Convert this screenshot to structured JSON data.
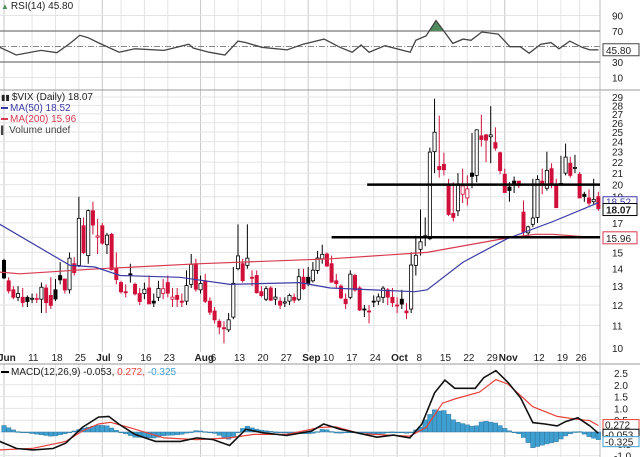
{
  "legend": {
    "rsi": "RSI(14) 45.80",
    "price": "$VIX (Daily) 18.07",
    "ma50": "MA(50) 18.52",
    "ma200": "MA(200) 15.96",
    "volume": "Volume undef",
    "macd_name": "MACD(12,26,9) -0.053,",
    "macd_signal": "0.272,",
    "macd_hist": "-0.325"
  },
  "colors": {
    "up": "#000000",
    "down": "#d0103a",
    "ma50": "#3b3ba6",
    "ma200": "#d83a50",
    "hist": "#3f9fd0",
    "rsi_fill": "#4e8a5a",
    "macd_signal": "#e8403a"
  },
  "chart_data": {
    "type": "candlestick",
    "symbol": "$VIX",
    "period": "Daily",
    "last_close": 18.07,
    "x_ticks": [
      {
        "i": 0,
        "label": "Jun",
        "month": true
      },
      {
        "i": 6,
        "label": "11"
      },
      {
        "i": 11,
        "label": "18"
      },
      {
        "i": 16,
        "label": "25"
      },
      {
        "i": 21,
        "label": "Jul",
        "month": true
      },
      {
        "i": 25,
        "label": "9"
      },
      {
        "i": 30,
        "label": "16"
      },
      {
        "i": 35,
        "label": "23"
      },
      {
        "i": 42,
        "label": "Aug",
        "month": true
      },
      {
        "i": 45,
        "label": "6"
      },
      {
        "i": 50,
        "label": "13"
      },
      {
        "i": 55,
        "label": "20"
      },
      {
        "i": 60,
        "label": "27"
      },
      {
        "i": 65,
        "label": "Sep",
        "month": true
      },
      {
        "i": 69,
        "label": "10"
      },
      {
        "i": 74,
        "label": "17"
      },
      {
        "i": 79,
        "label": "24"
      },
      {
        "i": 84,
        "label": "Oct",
        "month": true
      },
      {
        "i": 89,
        "label": "8"
      },
      {
        "i": 94,
        "label": "15"
      },
      {
        "i": 99,
        "label": "22"
      },
      {
        "i": 104,
        "label": "29"
      },
      {
        "i": 107,
        "label": "Nov",
        "month": true
      },
      {
        "i": 114,
        "label": "12"
      },
      {
        "i": 119,
        "label": "19"
      },
      {
        "i": 123,
        "label": "26"
      }
    ],
    "price_axis": {
      "scale": "log",
      "range": [
        10,
        29.5
      ],
      "ticks": [
        "29",
        "28",
        "27",
        "26",
        "25",
        "24",
        "23",
        "22",
        "21",
        "20",
        "19",
        "17",
        "15",
        "14",
        "13",
        "12",
        "11",
        "10"
      ]
    },
    "ohlc": [
      [
        14.5,
        14.6,
        13.4,
        13.46
      ],
      [
        13.3,
        13.5,
        12.6,
        12.74
      ],
      [
        12.8,
        13.0,
        12.3,
        12.4
      ],
      [
        12.4,
        13.0,
        12.2,
        12.6
      ],
      [
        12.4,
        12.9,
        11.9,
        12.13
      ],
      [
        12.4,
        12.5,
        11.9,
        12.18
      ],
      [
        12.3,
        12.6,
        12.1,
        12.35
      ],
      [
        12.3,
        12.6,
        12.1,
        12.34
      ],
      [
        12.3,
        13.2,
        11.6,
        12.94
      ],
      [
        12.9,
        13.1,
        11.6,
        12.12
      ],
      [
        12.5,
        13.5,
        11.8,
        11.98
      ],
      [
        12.8,
        13.4,
        12.2,
        12.31
      ],
      [
        13.6,
        14.4,
        13.1,
        13.35
      ],
      [
        13.4,
        13.4,
        12.6,
        12.79
      ],
      [
        12.8,
        15.0,
        12.6,
        14.64
      ],
      [
        14.3,
        14.7,
        13.6,
        13.77
      ],
      [
        14.2,
        19.0,
        14.1,
        17.33
      ],
      [
        16.8,
        17.4,
        14.9,
        14.99
      ],
      [
        14.8,
        18.0,
        14.3,
        17.91
      ],
      [
        17.9,
        18.6,
        16.2,
        16.85
      ],
      [
        16.0,
        17.3,
        14.9,
        16.09
      ],
      [
        16.8,
        17.0,
        15.5,
        15.6
      ],
      [
        15.5,
        16.3,
        14.9,
        16.14
      ],
      [
        16.2,
        16.3,
        13.9,
        13.94
      ],
      [
        14.0,
        15.0,
        13.1,
        13.37
      ],
      [
        13.2,
        13.3,
        12.6,
        12.69
      ],
      [
        12.7,
        13.1,
        12.4,
        12.64
      ],
      [
        13.7,
        14.3,
        13.2,
        13.63
      ],
      [
        13.1,
        13.2,
        12.5,
        12.58
      ],
      [
        12.6,
        12.9,
        12.0,
        12.18
      ],
      [
        12.6,
        13.2,
        12.3,
        12.83
      ],
      [
        12.9,
        13.6,
        12.1,
        12.06
      ],
      [
        12.2,
        12.6,
        11.9,
        12.1
      ],
      [
        12.4,
        13.3,
        12.2,
        12.87
      ],
      [
        12.6,
        13.4,
        12.3,
        12.86
      ],
      [
        13.2,
        13.6,
        12.4,
        12.62
      ],
      [
        12.3,
        12.9,
        11.9,
        12.41
      ],
      [
        12.5,
        12.9,
        11.9,
        12.29
      ],
      [
        12.2,
        12.6,
        11.9,
        12.14
      ],
      [
        12.2,
        13.9,
        12.0,
        13.03
      ],
      [
        13.1,
        14.9,
        12.9,
        14.26
      ],
      [
        14.3,
        14.6,
        12.7,
        12.83
      ],
      [
        12.8,
        13.6,
        12.6,
        13.15
      ],
      [
        13.3,
        13.7,
        12.1,
        12.19
      ],
      [
        12.2,
        12.4,
        11.5,
        11.64
      ],
      [
        11.7,
        11.9,
        11.1,
        11.27
      ],
      [
        11.2,
        11.3,
        10.6,
        10.93
      ],
      [
        10.9,
        11.2,
        10.2,
        10.85
      ],
      [
        10.8,
        11.6,
        10.7,
        11.27
      ],
      [
        11.4,
        14.1,
        11.3,
        13.16
      ],
      [
        14.0,
        16.9,
        13.9,
        14.78
      ],
      [
        14.3,
        14.6,
        13.2,
        13.31
      ],
      [
        14.2,
        16.9,
        14.0,
        14.64
      ],
      [
        13.5,
        13.9,
        13.0,
        13.45
      ],
      [
        13.6,
        13.9,
        12.6,
        12.64
      ],
      [
        12.7,
        13.0,
        12.4,
        12.49
      ],
      [
        12.3,
        13.0,
        12.2,
        12.86
      ],
      [
        12.9,
        13.0,
        12.2,
        12.25
      ],
      [
        12.3,
        12.9,
        12.0,
        12.41
      ],
      [
        12.2,
        12.4,
        11.8,
        11.99
      ],
      [
        12.1,
        12.4,
        11.9,
        12.16
      ],
      [
        12.2,
        12.6,
        12.0,
        12.5
      ],
      [
        12.4,
        12.6,
        12.1,
        12.25
      ],
      [
        12.3,
        14.0,
        12.2,
        13.53
      ],
      [
        13.5,
        14.0,
        12.8,
        12.86
      ],
      [
        13.5,
        14.1,
        13.0,
        13.16
      ],
      [
        13.3,
        14.4,
        13.2,
        13.91
      ],
      [
        13.9,
        15.1,
        13.7,
        14.65
      ],
      [
        14.6,
        15.5,
        14.3,
        14.88
      ],
      [
        14.9,
        15.0,
        14.1,
        14.16
      ],
      [
        14.3,
        14.8,
        13.2,
        13.22
      ],
      [
        13.3,
        13.7,
        12.9,
        13.14
      ],
      [
        13.0,
        13.1,
        12.3,
        12.37
      ],
      [
        12.3,
        12.6,
        11.8,
        12.07
      ],
      [
        12.4,
        13.9,
        12.3,
        13.68
      ],
      [
        13.6,
        13.7,
        12.7,
        12.79
      ],
      [
        12.9,
        13.0,
        11.7,
        11.75
      ],
      [
        11.8,
        12.0,
        11.4,
        11.8
      ],
      [
        11.7,
        12.0,
        11.1,
        11.68
      ],
      [
        12.2,
        12.5,
        11.9,
        12.2
      ],
      [
        12.2,
        12.6,
        12.0,
        12.42
      ],
      [
        12.4,
        13.0,
        12.1,
        12.89
      ],
      [
        12.8,
        12.9,
        12.0,
        12.41
      ],
      [
        12.4,
        12.9,
        11.9,
        12.12
      ],
      [
        12.0,
        12.4,
        11.6,
        12.0
      ],
      [
        12.3,
        12.8,
        11.8,
        12.05
      ],
      [
        11.7,
        12.1,
        11.3,
        11.61
      ],
      [
        11.8,
        15.0,
        11.6,
        14.22
      ],
      [
        14.2,
        16.1,
        13.6,
        14.82
      ],
      [
        15.2,
        18.0,
        14.8,
        15.69
      ],
      [
        16.1,
        17.4,
        15.4,
        15.95
      ],
      [
        15.9,
        23.4,
        15.8,
        22.96
      ],
      [
        23.0,
        28.8,
        21.0,
        24.98
      ],
      [
        21.6,
        26.8,
        20.6,
        21.31
      ],
      [
        21.8,
        22.9,
        20.8,
        21.3
      ],
      [
        20.0,
        20.5,
        17.5,
        17.62
      ],
      [
        17.7,
        20.2,
        17.1,
        17.4
      ],
      [
        17.9,
        21.0,
        17.5,
        20.06
      ],
      [
        19.2,
        21.4,
        18.5,
        19.89
      ],
      [
        18.9,
        20.8,
        18.3,
        19.64
      ],
      [
        21.0,
        24.9,
        19.7,
        20.71
      ],
      [
        20.8,
        25.3,
        20.2,
        25.23
      ],
      [
        24.6,
        26.9,
        23.5,
        24.22
      ],
      [
        24.7,
        24.8,
        22.0,
        24.16
      ],
      [
        24.5,
        27.9,
        21.9,
        24.7
      ],
      [
        23.9,
        25.5,
        23.1,
        23.35
      ],
      [
        22.9,
        23.0,
        20.9,
        21.23
      ],
      [
        20.9,
        21.4,
        19.3,
        19.34
      ],
      [
        19.8,
        20.2,
        18.6,
        19.51
      ],
      [
        20.3,
        20.7,
        19.3,
        19.96
      ],
      [
        20.3,
        20.3,
        19.7,
        19.91
      ],
      [
        17.8,
        18.7,
        16.1,
        16.36
      ],
      [
        16.3,
        16.8,
        16.0,
        16.72
      ],
      [
        16.9,
        20.5,
        16.7,
        17.36
      ],
      [
        17.4,
        20.8,
        17.0,
        20.45
      ],
      [
        20.3,
        21.4,
        19.2,
        20.02
      ],
      [
        19.7,
        23.0,
        19.5,
        21.25
      ],
      [
        21.4,
        21.9,
        19.7,
        19.98
      ],
      [
        20.0,
        20.5,
        18.1,
        18.14
      ],
      [
        20.0,
        22.6,
        19.9,
        20.1
      ],
      [
        21.0,
        23.8,
        20.8,
        22.48
      ],
      [
        21.9,
        22.5,
        20.6,
        20.8
      ],
      [
        21.5,
        22.7,
        21.0,
        21.52
      ],
      [
        20.9,
        21.1,
        18.9,
        18.9
      ],
      [
        19.2,
        19.4,
        18.6,
        19.02
      ],
      [
        18.9,
        19.6,
        18.3,
        18.49
      ],
      [
        18.6,
        20.5,
        18.4,
        18.79
      ],
      [
        19.0,
        19.4,
        17.9,
        18.07
      ]
    ],
    "ma50": [
      [
        -0.9,
        16.9
      ],
      [
        14.1,
        14.2
      ],
      [
        19.4,
        14.1
      ],
      [
        24.8,
        13.6
      ],
      [
        37.6,
        13.5
      ],
      [
        48.3,
        13.1
      ],
      [
        63.2,
        13.2
      ],
      [
        69.7,
        12.9
      ],
      [
        87.8,
        12.7
      ],
      [
        90.4,
        12.8
      ],
      [
        98.1,
        14.4
      ],
      [
        107.5,
        15.9
      ],
      [
        117.3,
        17.1
      ],
      [
        127,
        18.52
      ]
    ],
    "ma200": [
      [
        -0.9,
        13.8
      ],
      [
        3.4,
        13.7
      ],
      [
        20.5,
        14.0
      ],
      [
        41.9,
        14.3
      ],
      [
        69.7,
        14.6
      ],
      [
        90.4,
        15.0
      ],
      [
        107.5,
        15.95
      ],
      [
        113.5,
        16.2
      ],
      [
        117.3,
        16.2
      ],
      [
        127,
        15.96
      ]
    ],
    "annotation_lines": [
      {
        "value": 20,
        "from_index": 77.6
      },
      {
        "value": 16,
        "from_index": 70
      }
    ],
    "value_labels": {
      "ma50": "18.52",
      "close": "18.07",
      "ma200": "15.96"
    },
    "rsi": {
      "period": 14,
      "last": "45.80",
      "range": [
        0,
        100
      ],
      "ticks": [
        "90",
        "70",
        "30",
        "10"
      ],
      "overbought": 70,
      "oversold": 30,
      "points": [
        [
          -0.9,
          49
        ],
        [
          2.6,
          39
        ],
        [
          7.9,
          45
        ],
        [
          11.3,
          42
        ],
        [
          14.1,
          54
        ],
        [
          16.2,
          64.5
        ],
        [
          17.9,
          61.5
        ],
        [
          20.1,
          55
        ],
        [
          24.6,
          42.6
        ],
        [
          28,
          47
        ],
        [
          34.2,
          45
        ],
        [
          39.5,
          53
        ],
        [
          40.4,
          48
        ],
        [
          43.8,
          42.6
        ],
        [
          47.2,
          39
        ],
        [
          50,
          57
        ],
        [
          51.7,
          55
        ],
        [
          55.1,
          49
        ],
        [
          60.5,
          45.6
        ],
        [
          63.9,
          53
        ],
        [
          68.4,
          59.5
        ],
        [
          71.8,
          49
        ],
        [
          74.4,
          42.6
        ],
        [
          76.3,
          52
        ],
        [
          78,
          42.6
        ],
        [
          81.4,
          51
        ],
        [
          86.8,
          42.6
        ],
        [
          88,
          58
        ],
        [
          90.2,
          63.7
        ],
        [
          92.3,
          83.5
        ],
        [
          94.2,
          68
        ],
        [
          95.9,
          54
        ],
        [
          98.1,
          59.5
        ],
        [
          99.8,
          58
        ],
        [
          102.1,
          68.7
        ],
        [
          105.6,
          66
        ],
        [
          108.1,
          49.8
        ],
        [
          110.3,
          49.8
        ],
        [
          112.2,
          41.4
        ],
        [
          114.7,
          53
        ],
        [
          116.9,
          55
        ],
        [
          118.6,
          47
        ],
        [
          120.9,
          57
        ],
        [
          123.5,
          49
        ],
        [
          125.2,
          45.6
        ],
        [
          127,
          45.8
        ]
      ]
    },
    "macd": {
      "params": "12,26,9",
      "ticks": [
        "2.5",
        "2.0",
        "1.5",
        "1.0",
        "0.5",
        "-0.5",
        "-1.0"
      ],
      "value_labels": {
        "signal": "0.272",
        "macd": "-0.053",
        "hist": "-0.325"
      },
      "macd_line": [
        [
          -0.9,
          -0.4
        ],
        [
          2.7,
          -0.7
        ],
        [
          6.2,
          -0.76
        ],
        [
          10.5,
          -0.7
        ],
        [
          13.2,
          -0.47
        ],
        [
          16.7,
          0.19
        ],
        [
          20.2,
          0.63
        ],
        [
          22.4,
          0.66
        ],
        [
          24.5,
          0.34
        ],
        [
          28,
          -0.1
        ],
        [
          32.4,
          -0.4
        ],
        [
          37.7,
          -0.4
        ],
        [
          41.2,
          -0.25
        ],
        [
          44.7,
          -0.32
        ],
        [
          48.2,
          -0.57
        ],
        [
          51.7,
          0.12
        ],
        [
          55.2,
          -0.03
        ],
        [
          60.4,
          -0.15
        ],
        [
          65.7,
          0.04
        ],
        [
          68.3,
          0.34
        ],
        [
          71.8,
          0.12
        ],
        [
          75.3,
          -0.03
        ],
        [
          79.7,
          -0.22
        ],
        [
          83.2,
          -0.13
        ],
        [
          86.7,
          -0.25
        ],
        [
          89.3,
          0.34
        ],
        [
          92,
          1.66
        ],
        [
          94.2,
          2.2
        ],
        [
          96.3,
          1.85
        ],
        [
          100.7,
          1.85
        ],
        [
          102.5,
          2.3
        ],
        [
          105.1,
          2.6
        ],
        [
          107.7,
          2.1
        ],
        [
          110.4,
          1.44
        ],
        [
          113,
          0.4
        ],
        [
          115.6,
          0.34
        ],
        [
          118.2,
          0.26
        ],
        [
          120,
          0.44
        ],
        [
          122.6,
          0.6
        ],
        [
          125.2,
          0.26
        ],
        [
          127,
          -0.053
        ]
      ],
      "signal_line": [
        [
          -0.9,
          -0.76
        ],
        [
          6.2,
          -0.69
        ],
        [
          13.2,
          -0.4
        ],
        [
          16.7,
          0.04
        ],
        [
          20.2,
          0.34
        ],
        [
          22.8,
          0.41
        ],
        [
          28,
          0.12
        ],
        [
          34.2,
          -0.25
        ],
        [
          41.2,
          -0.32
        ],
        [
          48.2,
          -0.25
        ],
        [
          53.4,
          -0.1
        ],
        [
          60.4,
          -0.1
        ],
        [
          67.4,
          0.19
        ],
        [
          70.9,
          0.22
        ],
        [
          76.2,
          -0.07
        ],
        [
          86.7,
          -0.18
        ],
        [
          90.2,
          0.19
        ],
        [
          93.7,
          1.22
        ],
        [
          96.3,
          1.4
        ],
        [
          101.6,
          1.69
        ],
        [
          105.1,
          2.22
        ],
        [
          107.7,
          2.03
        ],
        [
          113,
          1.07
        ],
        [
          118.2,
          0.66
        ],
        [
          121.7,
          0.56
        ],
        [
          125.2,
          0.48
        ],
        [
          127,
          0.272
        ]
      ]
    }
  }
}
